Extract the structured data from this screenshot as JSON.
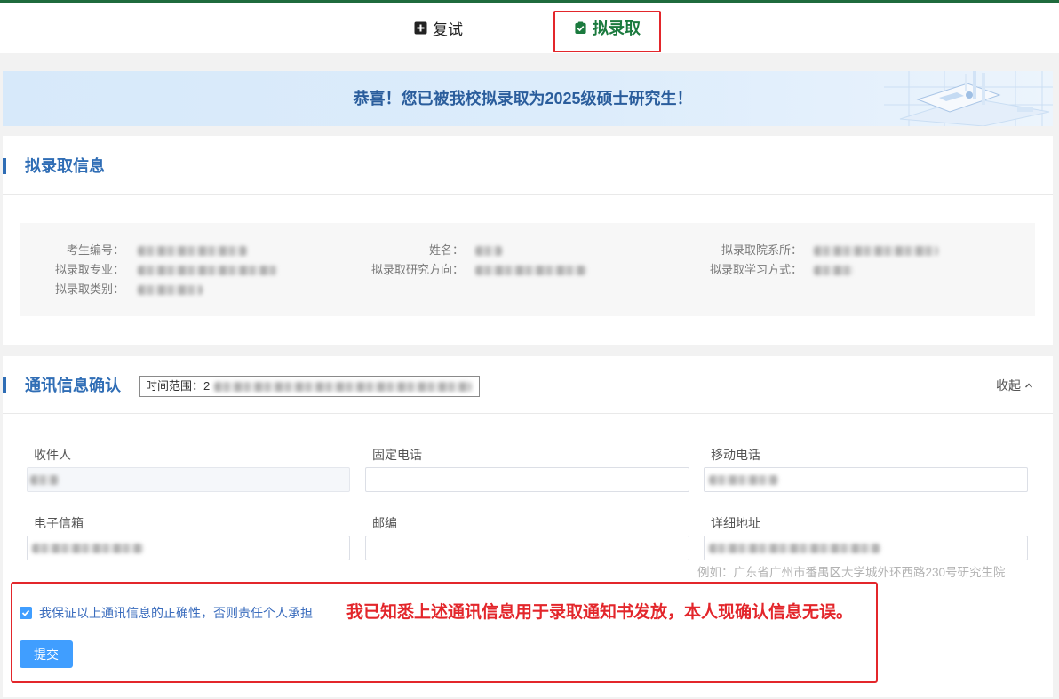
{
  "colors": {
    "brand_green": "#1b7a3e",
    "top_bar": "#1f6b3d",
    "accent_blue": "#409eff",
    "section_title": "#2f6db5",
    "banner_text": "#2a5d9c",
    "annotation_red": "#e3262b"
  },
  "tabs": [
    {
      "label": "复试",
      "icon": "document-plus-icon",
      "active": false
    },
    {
      "label": "拟录取",
      "icon": "shield-check-icon",
      "active": true
    }
  ],
  "banner": {
    "message": "恭喜！您已被我校拟录取为2025级硕士研究生！"
  },
  "admission_info": {
    "title": "拟录取信息",
    "fields": [
      {
        "label": "考生编号："
      },
      {
        "label": "姓名："
      },
      {
        "label": "拟录取院系所："
      },
      {
        "label": "拟录取专业："
      },
      {
        "label": "拟录取研究方向："
      },
      {
        "label": "拟录取学习方式："
      },
      {
        "label": "拟录取类别："
      }
    ]
  },
  "contact_confirm": {
    "title": "通讯信息确认",
    "time_range": "时间范围：2",
    "collapse_label": "收起",
    "collapse_icon": "chevron-up-icon",
    "fields": [
      {
        "label": "收件人",
        "disabled": true
      },
      {
        "label": "固定电话",
        "value": ""
      },
      {
        "label": "移动电话"
      },
      {
        "label": "电子信箱"
      },
      {
        "label": "邮编",
        "value": ""
      },
      {
        "label": "详细地址"
      }
    ],
    "address_hint": "例如：广东省广州市番禺区大学城外环西路230号研究生院",
    "agreement": {
      "checked": true,
      "label": "我保证以上通讯信息的正确性，否则责任个人承担"
    },
    "submit_label": "提交"
  },
  "annotation": {
    "note": "我已知悉上述通讯信息用于录取通知书发放，本人现确认信息无误。"
  }
}
